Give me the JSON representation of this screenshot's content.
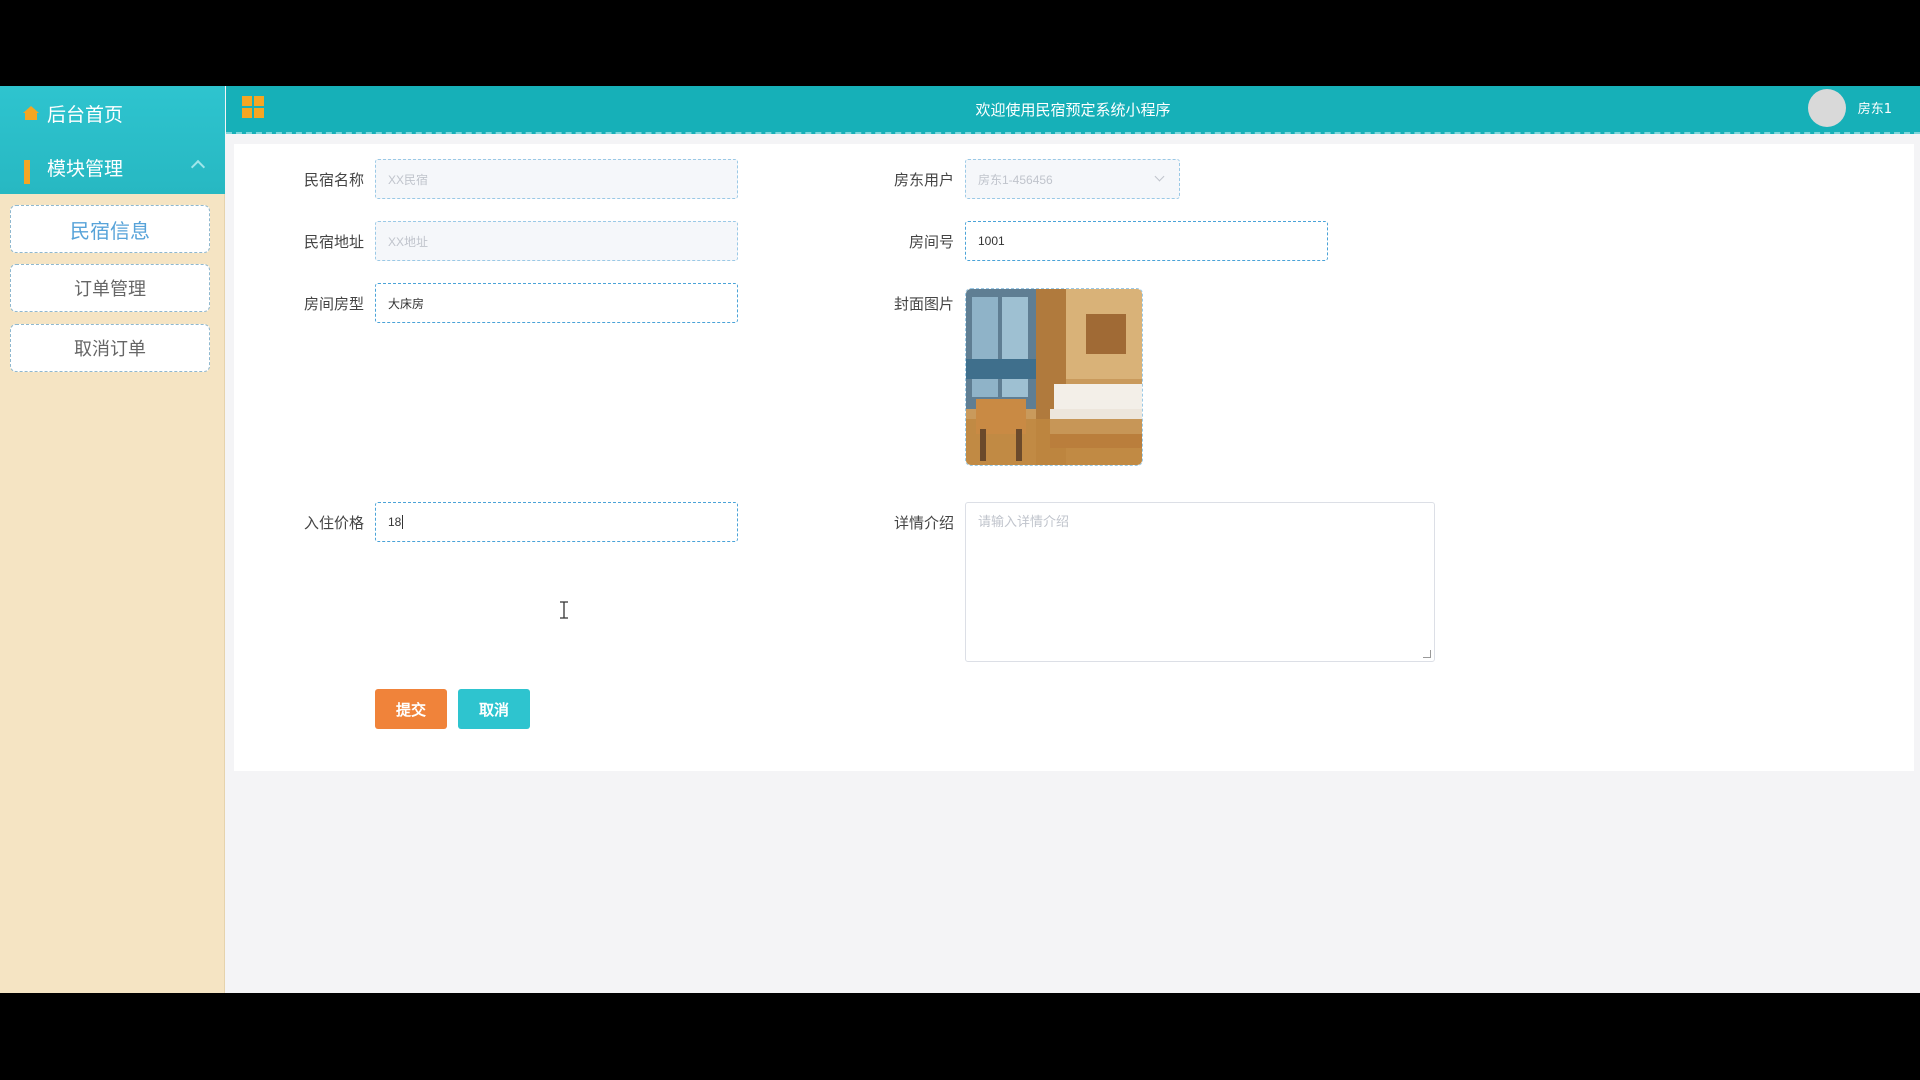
{
  "sidebar": {
    "home_label": "后台首页",
    "module_label": "模块管理",
    "items": [
      {
        "label": "民宿信息"
      },
      {
        "label": "订单管理"
      },
      {
        "label": "取消订单"
      }
    ]
  },
  "topbar": {
    "title": "欢迎使用民宿预定系统小程序",
    "user": "房东1"
  },
  "form": {
    "name_label": "民宿名称",
    "name_placeholder": "XX民宿",
    "address_label": "民宿地址",
    "address_placeholder": "XX地址",
    "room_type_label": "房间房型",
    "room_type_value": "大床房",
    "price_label": "入住价格",
    "price_value": "18",
    "owner_label": "房东用户",
    "owner_value": "房东1-456456",
    "room_no_label": "房间号",
    "room_no_value": "1001",
    "cover_label": "封面图片",
    "detail_label": "详情介绍",
    "detail_placeholder": "请输入详情介绍",
    "submit_label": "提交",
    "cancel_label": "取消"
  },
  "colors": {
    "accent": "#16b0b8",
    "sidebar_bg": "#f5e4c3",
    "submit": "#f0833a",
    "cancel": "#2ec4cf"
  }
}
